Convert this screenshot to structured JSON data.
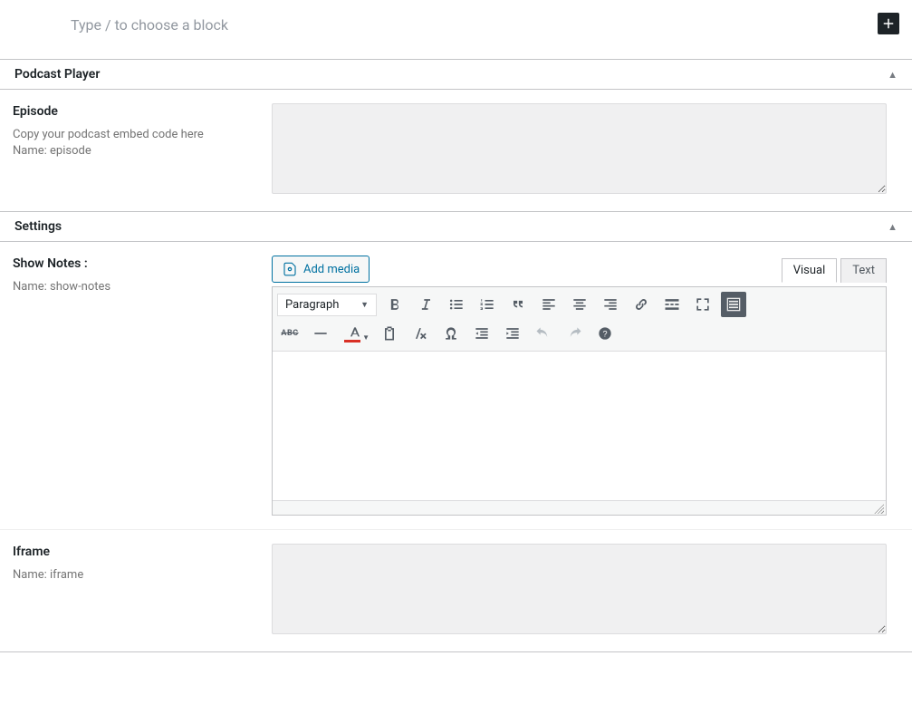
{
  "editor": {
    "block_placeholder": "Type / to choose a block"
  },
  "metaboxes": {
    "podcast_player": {
      "title": "Podcast Player",
      "fields": {
        "episode": {
          "label": "Episode",
          "hint_line1": "Copy your podcast embed code here",
          "hint_line2": "Name: episode",
          "value": ""
        }
      }
    },
    "settings": {
      "title": "Settings",
      "fields": {
        "show_notes": {
          "label": "Show Notes :",
          "hint": "Name: show-notes",
          "add_media_label": "Add media",
          "tabs": {
            "visual": "Visual",
            "text": "Text",
            "active": "visual"
          },
          "format_select": "Paragraph",
          "content": ""
        },
        "iframe": {
          "label": "Iframe",
          "hint": "Name: iframe",
          "value": ""
        }
      }
    }
  },
  "toolbar_icons": {
    "bold": "bold-icon",
    "italic": "italic-icon",
    "ul": "bullet-list-icon",
    "ol": "numbered-list-icon",
    "quote": "quote-icon",
    "align_left": "align-left-icon",
    "align_center": "align-center-icon",
    "align_right": "align-right-icon",
    "link": "link-icon",
    "more": "read-more-icon",
    "fullscreen": "fullscreen-icon",
    "kitchen_sink": "toolbar-toggle-icon",
    "strike": "strikethrough-icon",
    "hr": "horizontal-rule-icon",
    "text_color": "text-color-icon",
    "paste": "paste-text-icon",
    "clear": "clear-formatting-icon",
    "special": "special-char-icon",
    "outdent": "outdent-icon",
    "indent": "indent-icon",
    "undo": "undo-icon",
    "redo": "redo-icon",
    "help": "help-icon"
  }
}
